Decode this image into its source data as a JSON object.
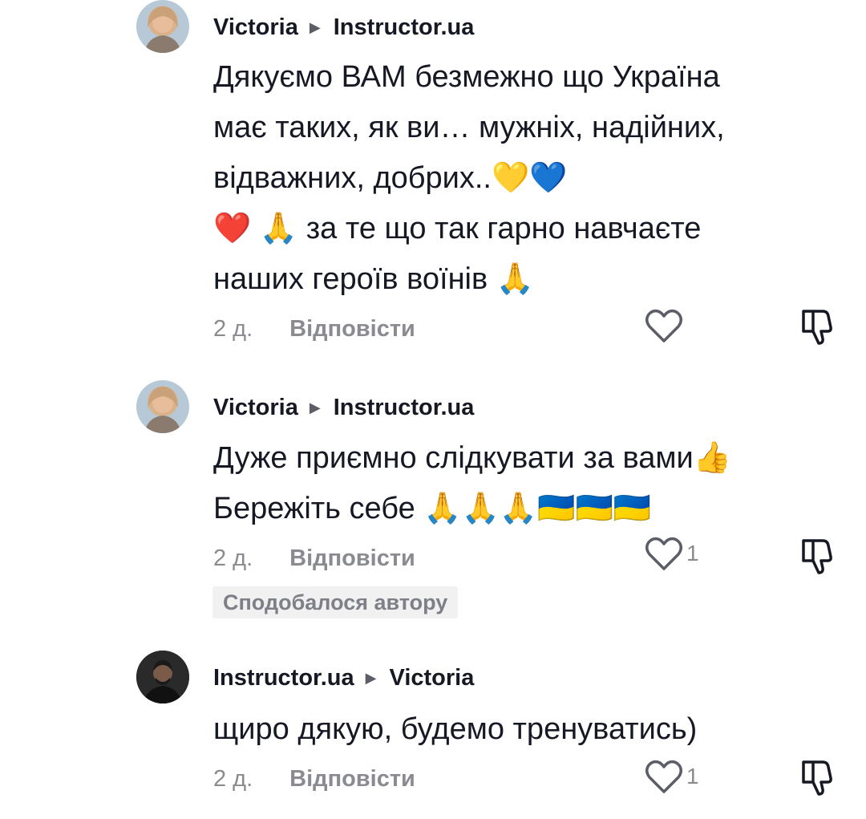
{
  "comments": [
    {
      "author": "Victoria",
      "reply_to": "Instructor.ua",
      "text": "Дякуємо ВАМ безмежно що Україна\nмає таких, як ви… мужніх, надійних,\nвідважних, добрих..💛💙\n❤️ 🙏 за те що так гарно навчаєте\nнаших героїв воїнів 🙏",
      "time": "2 д.",
      "reply_label": "Відповісти",
      "likes": ""
    },
    {
      "author": "Victoria",
      "reply_to": "Instructor.ua",
      "text": "Дуже приємно слідкувати за вами👍\nБережіть себе 🙏🙏🙏🇺🇦🇺🇦🇺🇦",
      "time": "2 д.",
      "reply_label": "Відповісти",
      "likes": "1",
      "badge": "Сподобалося автору"
    },
    {
      "author": "Instructor.ua",
      "reply_to": "Victoria",
      "text": "щиро дякую, будемо тренуватись)",
      "time": "2 д.",
      "reply_label": "Відповісти",
      "likes": "1"
    }
  ],
  "icons": {
    "reply_arrow": "triangle-right-icon",
    "like": "heart-outline-icon",
    "dislike": "thumbs-down-outline-icon"
  }
}
